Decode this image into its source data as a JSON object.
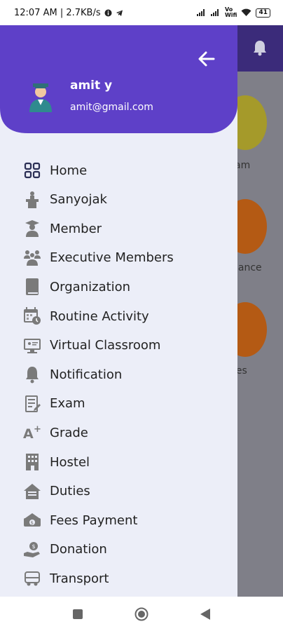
{
  "statusbar": {
    "time_info": "12:07 AM | 2.7KB/s",
    "battery": "41"
  },
  "background": {
    "labels": [
      "am",
      "dance",
      "ies"
    ]
  },
  "drawer": {
    "user_name": "amit y",
    "user_email": "amit@gmail.com",
    "items": [
      {
        "label": "Home",
        "icon": "grid-icon"
      },
      {
        "label": "Sanyojak",
        "icon": "podium-icon"
      },
      {
        "label": "Member",
        "icon": "graduate-icon"
      },
      {
        "label": "Executive Members",
        "icon": "people-icon"
      },
      {
        "label": "Organization",
        "icon": "book-icon"
      },
      {
        "label": "Routine Activity",
        "icon": "calendar-icon"
      },
      {
        "label": "Virtual Classroom",
        "icon": "monitor-icon"
      },
      {
        "label": "Notification",
        "icon": "bell-icon"
      },
      {
        "label": "Exam",
        "icon": "exam-icon"
      },
      {
        "label": "Grade",
        "icon": "grade-icon"
      },
      {
        "label": "Hostel",
        "icon": "building-icon"
      },
      {
        "label": "Duties",
        "icon": "house-icon"
      },
      {
        "label": "Fees Payment",
        "icon": "money-icon"
      },
      {
        "label": "Donation",
        "icon": "donation-icon"
      },
      {
        "label": "Transport",
        "icon": "bus-icon"
      }
    ]
  },
  "colors": {
    "drawer_header": "#5e40c8",
    "drawer_body": "#eceef8",
    "icon": "#7a7a7a"
  }
}
